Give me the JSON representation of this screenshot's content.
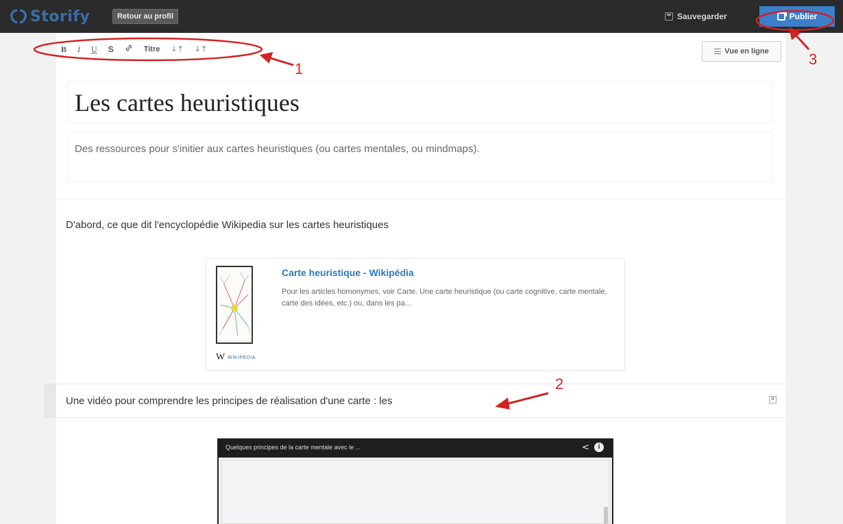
{
  "topbar": {
    "logo_text": "Storify",
    "back_label": "Retour au profil",
    "save_label": "Sauvegarder",
    "publish_label": "Publier",
    "accent_color": "#3b7fcb",
    "icons": {
      "logo": "storify-logo-icon",
      "save": "save-icon",
      "publish": "publish-icon"
    }
  },
  "toolbar": {
    "bold": "B",
    "italic": "I",
    "underline": "U",
    "strike": "S",
    "link_icon": "🔗",
    "heading": "Titre",
    "sort_desc": "↓↑",
    "sort_asc": "↓↑",
    "view_label": "Vue en ligne"
  },
  "story": {
    "title": "Les cartes heuristiques",
    "description": "Des ressources pour s'initier aux cartes heuristiques (ou cartes mentales, ou mindmaps)."
  },
  "paragraph1": "D'abord, ce que dit l'encyclopédie Wikipedia sur les cartes heuristiques",
  "wiki_card": {
    "title": "Carte heuristique - Wikipédia",
    "snippet": "Pour les articles homonymes, voir Carte. Une carte heuristique (ou carte cognitive, carte mentale, carte des idées, etc.) ou, dans les pa...",
    "source_letter": "W",
    "source_name": "WIKIPEDIA"
  },
  "caption": {
    "text": "Une vidéo pour comprendre les principes de réalisation d'une carte : les",
    "close_glyph": "✕"
  },
  "video": {
    "title": "Quelques principes de la carte mentale avec le ...",
    "share_glyph": "<",
    "info_glyph": "i"
  },
  "annotations": {
    "label_1": "1",
    "label_2": "2",
    "label_3": "3",
    "color": "#d22222"
  }
}
